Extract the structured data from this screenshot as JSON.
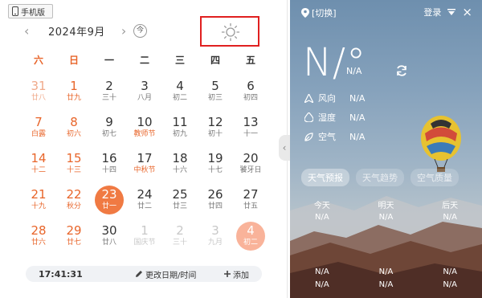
{
  "header": {
    "mobile_label": "手机版",
    "month_label": "2024年9月",
    "prev_symbol": "‹",
    "next_symbol": "›",
    "today_label": "今"
  },
  "weekdays": [
    "六",
    "日",
    "一",
    "二",
    "三",
    "四",
    "五"
  ],
  "weeks": [
    [
      {
        "d": "31",
        "l": "廿八",
        "t": "prev"
      },
      {
        "d": "1",
        "l": "廿九",
        "t": "wk"
      },
      {
        "d": "2",
        "l": "三十"
      },
      {
        "d": "3",
        "l": "八月"
      },
      {
        "d": "4",
        "l": "初二"
      },
      {
        "d": "5",
        "l": "初三"
      },
      {
        "d": "6",
        "l": "初四"
      }
    ],
    [
      {
        "d": "7",
        "l": "白露",
        "t": "wk"
      },
      {
        "d": "8",
        "l": "初六",
        "t": "wk"
      },
      {
        "d": "9",
        "l": "初七"
      },
      {
        "d": "10",
        "l": "教师节",
        "t": "fest"
      },
      {
        "d": "11",
        "l": "初九"
      },
      {
        "d": "12",
        "l": "初十"
      },
      {
        "d": "13",
        "l": "十一"
      }
    ],
    [
      {
        "d": "14",
        "l": "十二",
        "t": "wk"
      },
      {
        "d": "15",
        "l": "十三",
        "t": "wk"
      },
      {
        "d": "16",
        "l": "十四"
      },
      {
        "d": "17",
        "l": "中秋节",
        "t": "fest"
      },
      {
        "d": "18",
        "l": "十六"
      },
      {
        "d": "19",
        "l": "十七"
      },
      {
        "d": "20",
        "l": "饕牙日"
      }
    ],
    [
      {
        "d": "21",
        "l": "十九",
        "t": "wk"
      },
      {
        "d": "22",
        "l": "秋分",
        "t": "wk"
      },
      {
        "d": "23",
        "l": "廿一",
        "t": "today"
      },
      {
        "d": "24",
        "l": "廿二"
      },
      {
        "d": "25",
        "l": "廿三"
      },
      {
        "d": "26",
        "l": "廿四"
      },
      {
        "d": "27",
        "l": "廿五"
      }
    ],
    [
      {
        "d": "28",
        "l": "廿六",
        "t": "wk"
      },
      {
        "d": "29",
        "l": "廿七",
        "t": "wk"
      },
      {
        "d": "30",
        "l": "廿八"
      },
      {
        "d": "1",
        "l": "国庆节",
        "t": "next"
      },
      {
        "d": "2",
        "l": "三十",
        "t": "next"
      },
      {
        "d": "3",
        "l": "九月",
        "t": "next"
      },
      {
        "d": "4",
        "l": "初二",
        "t": "sel"
      }
    ]
  ],
  "footer": {
    "time": "17:41:31",
    "edit_label": "更改日期/时间",
    "add_label": "添加"
  },
  "collapse_symbol": "‹",
  "weather": {
    "location": "[切换]",
    "login": "登录",
    "close": "×",
    "temp": "N/°",
    "temp_sub": "N/A",
    "rows": [
      {
        "icon": "wind-icon",
        "label": "风向",
        "value": "N/A"
      },
      {
        "icon": "humidity-icon",
        "label": "湿度",
        "value": "N/A"
      },
      {
        "icon": "air-icon",
        "label": "空气",
        "value": "N/A"
      }
    ],
    "tabs": [
      "天气预报",
      "天气趋势",
      "空气质量"
    ],
    "days": [
      "今天",
      "明天",
      "后天"
    ],
    "day_values": [
      "N/A",
      "N/A",
      "N/A"
    ],
    "night_values_1": [
      "N/A",
      "N/A",
      "N/A"
    ],
    "night_values_2": [
      "N/A",
      "N/A",
      "N/A"
    ]
  },
  "colors": {
    "accent": "#f07a43",
    "weekend": "#e8652a",
    "highlight_box": "#e02020"
  }
}
